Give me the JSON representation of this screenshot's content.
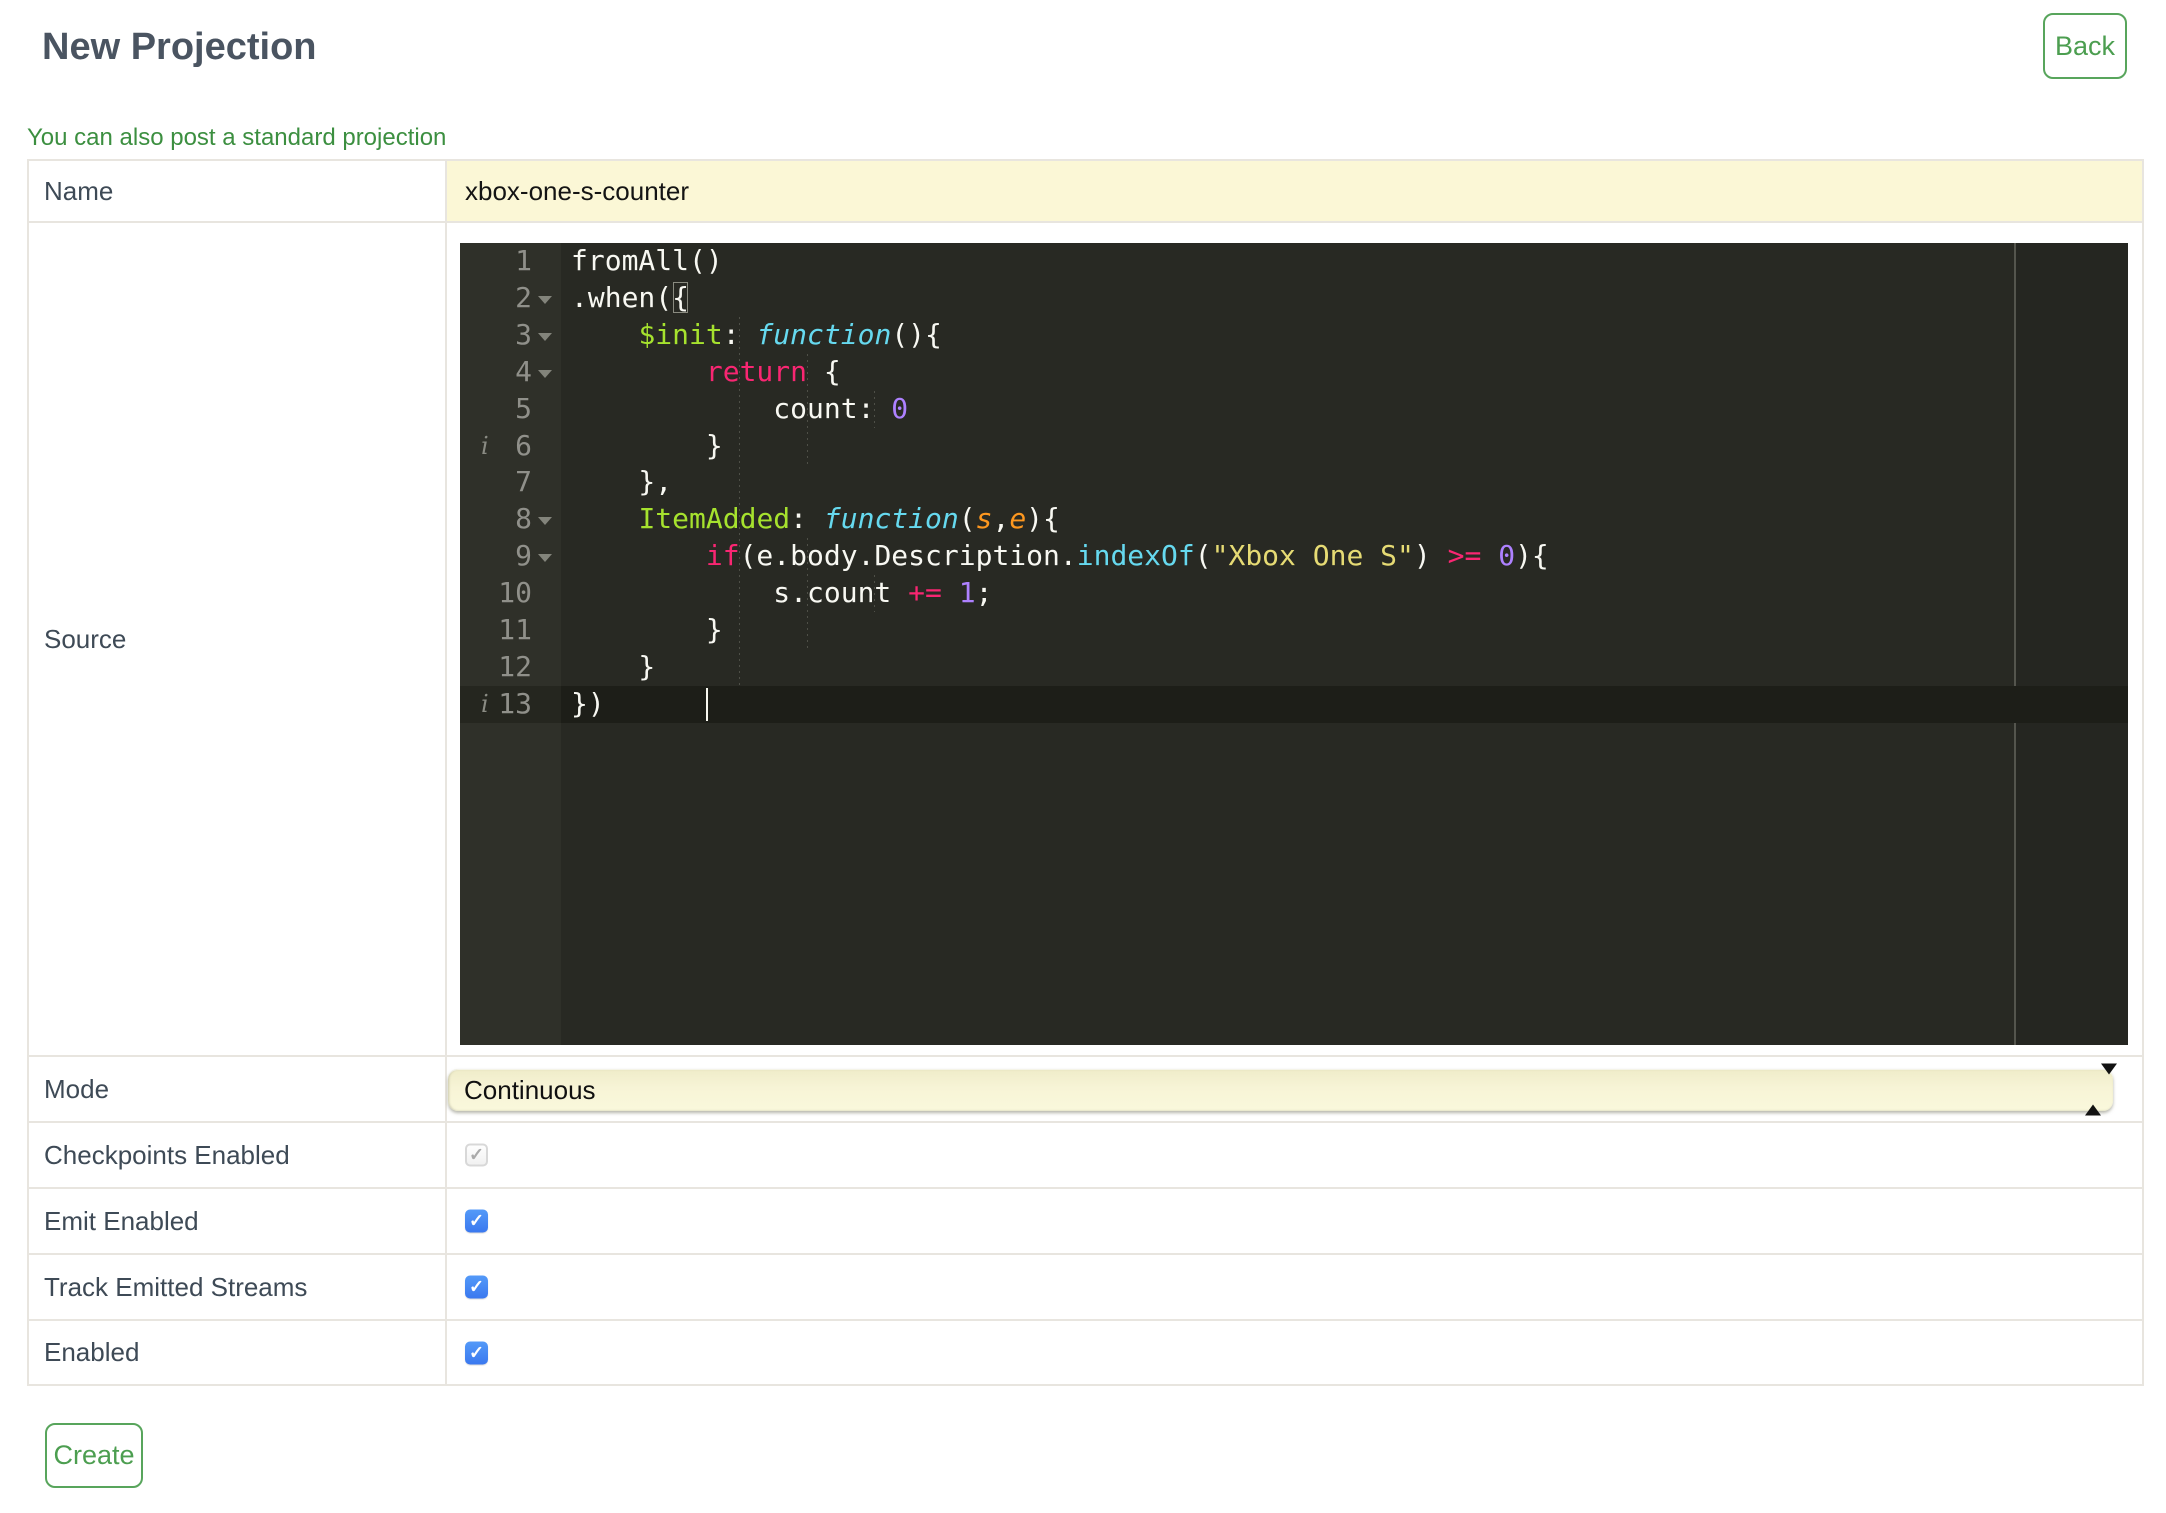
{
  "page": {
    "title": "New Projection"
  },
  "header": {
    "back_label": "Back"
  },
  "link": {
    "text": "You can also post a standard projection"
  },
  "form": {
    "name": {
      "label": "Name",
      "value": "xbox-one-s-counter"
    },
    "source": {
      "label": "Source"
    },
    "mode": {
      "label": "Mode",
      "value": "Continuous"
    },
    "checkpoints": {
      "label": "Checkpoints Enabled",
      "checked": true,
      "disabled": true
    },
    "emit": {
      "label": "Emit Enabled",
      "checked": true,
      "disabled": false
    },
    "track": {
      "label": "Track Emitted Streams",
      "checked": true,
      "disabled": false
    },
    "enabled": {
      "label": "Enabled",
      "checked": true,
      "disabled": false
    }
  },
  "editor": {
    "lines": [
      {
        "num": 1,
        "segs": [
          [
            "t",
            "fromAll()"
          ]
        ]
      },
      {
        "num": 2,
        "fold": true,
        "segs": [
          [
            "t",
            ".when("
          ],
          [
            "bm",
            "{"
          ]
        ]
      },
      {
        "num": 3,
        "fold": true,
        "segs": [
          [
            "t",
            "    "
          ],
          [
            "e",
            "$init"
          ],
          [
            "t",
            ": "
          ],
          [
            "f",
            "function"
          ],
          [
            "t",
            "(){"
          ]
        ]
      },
      {
        "num": 4,
        "fold": true,
        "segs": [
          [
            "t",
            "        "
          ],
          [
            "k",
            "return"
          ],
          [
            "t",
            " {"
          ]
        ]
      },
      {
        "num": 5,
        "segs": [
          [
            "t",
            "            count: "
          ],
          [
            "n",
            "0"
          ]
        ]
      },
      {
        "num": 6,
        "ann": true,
        "segs": [
          [
            "t",
            "        }"
          ]
        ]
      },
      {
        "num": 7,
        "segs": [
          [
            "t",
            "    },"
          ]
        ]
      },
      {
        "num": 8,
        "fold": true,
        "segs": [
          [
            "t",
            "    "
          ],
          [
            "e",
            "ItemAdded"
          ],
          [
            "t",
            ": "
          ],
          [
            "f",
            "function"
          ],
          [
            "t",
            "("
          ],
          [
            "p",
            "s"
          ],
          [
            "t",
            ","
          ],
          [
            "p",
            "e"
          ],
          [
            "t",
            "){"
          ]
        ]
      },
      {
        "num": 9,
        "fold": true,
        "segs": [
          [
            "t",
            "        "
          ],
          [
            "k",
            "if"
          ],
          [
            "t",
            "(e.body.Description."
          ],
          [
            "s",
            "indexOf"
          ],
          [
            "t",
            "("
          ],
          [
            "str",
            "\"Xbox One S\""
          ],
          [
            "t",
            ") "
          ],
          [
            "k",
            ">="
          ],
          [
            "t",
            " "
          ],
          [
            "n",
            "0"
          ],
          [
            "t",
            "){"
          ]
        ]
      },
      {
        "num": 10,
        "segs": [
          [
            "t",
            "            s.count "
          ],
          [
            "k",
            "+="
          ],
          [
            "t",
            " "
          ],
          [
            "n",
            "1"
          ],
          [
            "t",
            ";"
          ]
        ]
      },
      {
        "num": 11,
        "segs": [
          [
            "t",
            "        }"
          ]
        ]
      },
      {
        "num": 12,
        "segs": [
          [
            "t",
            "    }"
          ]
        ]
      },
      {
        "num": 13,
        "ann": true,
        "active": true,
        "cursor": true,
        "segs": [
          [
            "t",
            "})"
          ]
        ]
      }
    ]
  },
  "footer": {
    "create_label": "Create"
  },
  "colors": {
    "accent_green": "#4c9e50",
    "link_green": "#3c8f40",
    "field_yellow": "#fbf7d6",
    "checkbox_blue": "#4285f4",
    "editor_bg": "#282923",
    "editor_gutter": "#2f3029",
    "token_keyword": "#f92672",
    "token_entity": "#a6e22e",
    "token_function": "#66d9ef",
    "token_string": "#e6db74",
    "token_number": "#ae81ff",
    "token_param": "#fd971f"
  }
}
